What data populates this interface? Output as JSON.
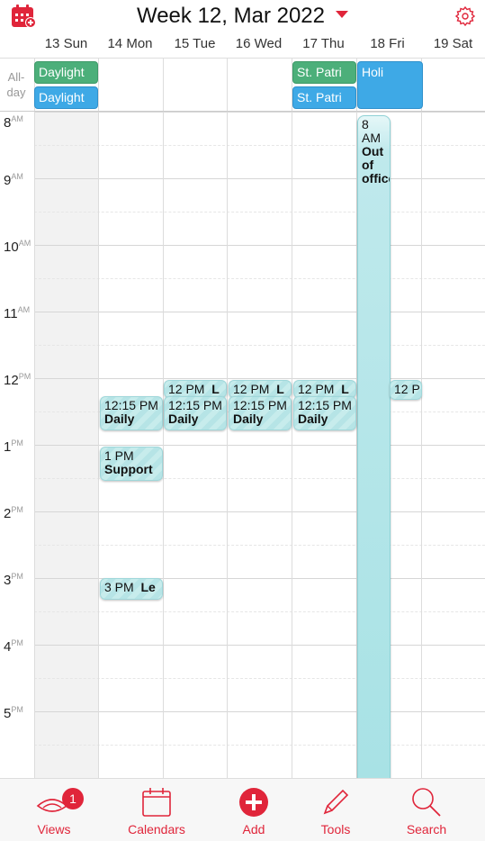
{
  "header": {
    "title": "Week 12, Mar 2022",
    "accent": "#e0253a",
    "days": [
      "13 Sun",
      "14 Mon",
      "15 Tue",
      "16 Wed",
      "17 Thu",
      "18 Fri",
      "19 Sat"
    ]
  },
  "allday": {
    "label_line1": "All-",
    "label_line2": "day",
    "events": [
      {
        "text": "Daylight",
        "color": "green"
      },
      {
        "text": "Daylight",
        "color": "blue"
      },
      {
        "text": "St. Patri",
        "color": "green"
      },
      {
        "text": "St. Patri",
        "color": "blue"
      },
      {
        "text": "Holi",
        "color": "blue"
      }
    ]
  },
  "hours": [
    {
      "num": "8",
      "ap": "AM"
    },
    {
      "num": "9",
      "ap": "AM"
    },
    {
      "num": "10",
      "ap": "AM"
    },
    {
      "num": "11",
      "ap": "AM"
    },
    {
      "num": "12",
      "ap": "PM"
    },
    {
      "num": "1",
      "ap": "PM"
    },
    {
      "num": "2",
      "ap": "PM"
    },
    {
      "num": "3",
      "ap": "PM"
    },
    {
      "num": "4",
      "ap": "PM"
    },
    {
      "num": "5",
      "ap": "PM"
    }
  ],
  "events": {
    "out_of_office": {
      "time": "8 AM",
      "title": "Out of office"
    },
    "lunch_tue": {
      "time": "12 PM",
      "title": "L"
    },
    "lunch_wed": {
      "time": "12 PM",
      "title": "L"
    },
    "lunch_thu": {
      "time": "12 PM",
      "title": "L"
    },
    "sat_noon": {
      "time": "12 P",
      "title": ""
    },
    "daily_mon": {
      "time": "12:15 PM",
      "title": "Daily"
    },
    "daily_tue": {
      "time": "12:15 PM",
      "title": "Daily"
    },
    "daily_wed": {
      "time": "12:15 PM",
      "title": "Daily"
    },
    "daily_thu": {
      "time": "12:15 PM",
      "title": "Daily"
    },
    "support_mon": {
      "time": "1 PM",
      "title": "Support"
    },
    "le_mon": {
      "time": "3 PM",
      "title": "Le"
    }
  },
  "tabbar": {
    "views": "Views",
    "views_badge": "1",
    "calendars": "Calendars",
    "add": "Add",
    "tools": "Tools",
    "search": "Search"
  }
}
